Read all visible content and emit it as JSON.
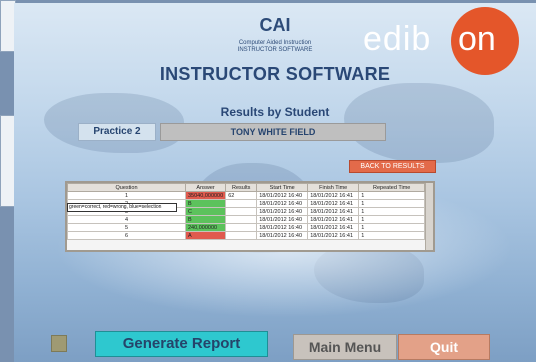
{
  "header": {
    "logo_text": "CAI",
    "logo_sub1": "Computer Aided Instruction",
    "logo_sub2": "INSTRUCTOR SOFTWARE",
    "brand_left": "edib",
    "brand_right": "on",
    "title": "INSTRUCTOR SOFTWARE",
    "subtitle": "Results by Student"
  },
  "practice": {
    "label": "Practice 2",
    "student": "TONY WHITE FIELD"
  },
  "back_button": "BACK TO RESULTS",
  "legend": "green=correct, red=wrong, blue=selection",
  "table": {
    "columns": [
      "Question",
      "Answer",
      "Results",
      "Start Time",
      "Finish Time",
      "Repeated Time"
    ],
    "rows": [
      {
        "q": "1",
        "a": "35040,000000",
        "status": "wrong",
        "r": "62",
        "start": "18/01/2012 16:40",
        "finish": "18/01/2012 16:41",
        "rep": "1"
      },
      {
        "q": "2",
        "a": "B",
        "status": "correct",
        "r": "",
        "start": "18/01/2012 16:40",
        "finish": "18/01/2012 16:41",
        "rep": "1"
      },
      {
        "q": "3",
        "a": "C",
        "status": "correct",
        "r": "",
        "start": "18/01/2012 16:40",
        "finish": "18/01/2012 16:41",
        "rep": "1"
      },
      {
        "q": "4",
        "a": "B",
        "status": "correct",
        "r": "",
        "start": "18/01/2012 16:40",
        "finish": "18/01/2012 16:41",
        "rep": "1"
      },
      {
        "q": "5",
        "a": "240,000000",
        "status": "correct",
        "r": "",
        "start": "18/01/2012 16:40",
        "finish": "18/01/2012 16:41",
        "rep": "1"
      },
      {
        "q": "6",
        "a": "A",
        "status": "wrong",
        "r": "",
        "start": "18/01/2012 16:40",
        "finish": "18/01/2012 16:41",
        "rep": "1"
      }
    ]
  },
  "buttons": {
    "generate": "Generate Report",
    "main_menu": "Main Menu",
    "quit": "Quit"
  },
  "colors": {
    "correct": "#5cc25c",
    "wrong": "#e05a4e",
    "accent": "#2ec8cf",
    "brand": "#e4562a"
  }
}
